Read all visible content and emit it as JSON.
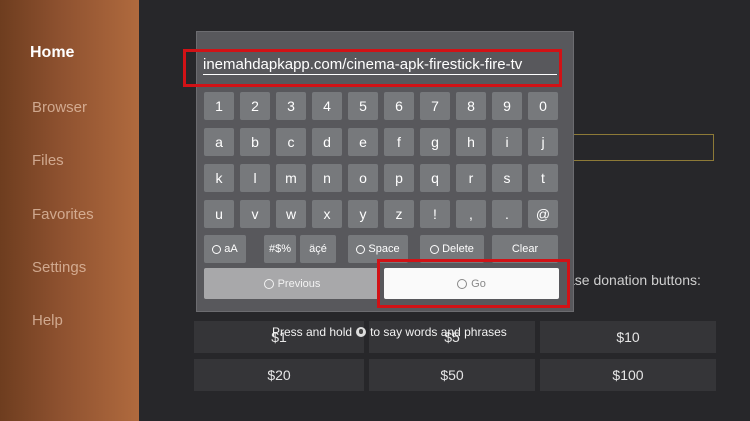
{
  "sidebar": {
    "items": [
      {
        "label": "Home"
      },
      {
        "label": "Browser"
      },
      {
        "label": "Files"
      },
      {
        "label": "Favorites"
      },
      {
        "label": "Settings"
      },
      {
        "label": "Help"
      }
    ]
  },
  "main": {
    "donation_text": "ase donation buttons:",
    "donation_text2": ")",
    "donation_buttons": [
      "$1",
      "$5",
      "$10",
      "$20",
      "$50",
      "$100"
    ]
  },
  "keyboard": {
    "url_value": "inemahdapkapp.com/cinema-apk-firestick-fire-tv",
    "rows": [
      [
        "1",
        "2",
        "3",
        "4",
        "5",
        "6",
        "7",
        "8",
        "9",
        "0"
      ],
      [
        "a",
        "b",
        "c",
        "d",
        "e",
        "f",
        "g",
        "h",
        "i",
        "j"
      ],
      [
        "k",
        "l",
        "m",
        "n",
        "o",
        "p",
        "q",
        "r",
        "s",
        "t"
      ],
      [
        "u",
        "v",
        "w",
        "x",
        "y",
        "z",
        "!",
        ",",
        ".",
        "@"
      ]
    ],
    "func_keys": {
      "case": "aA",
      "symbols": "#$%",
      "accents": "äçé",
      "space": "Space",
      "delete": "Delete",
      "clear": "Clear"
    },
    "previous_label": "Previous",
    "go_label": "Go",
    "hint": "Press and hold",
    "hint_tail": "to say words and phrases"
  },
  "colors": {
    "highlight": "#d11216",
    "sidebar_brand": "#b06a3e"
  }
}
